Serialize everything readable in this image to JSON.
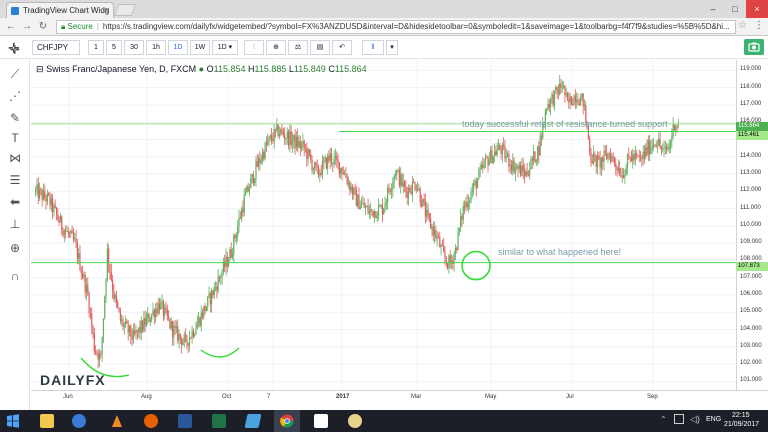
{
  "browser": {
    "tab_title": "TradingView Chart Widg",
    "address_secure": "Secure",
    "url": "https://s.tradingview.com/dailyfx/widgetembed/?symbol=FX%3ANZDUSD&interval=D&hidesidetoolbar=0&symboledit=1&saveimage=1&toolbarbg=f4f7f9&studies=%5B%5D&hi..."
  },
  "toolbar": {
    "symbol": "CHFJPY",
    "intervals": [
      "1",
      "5",
      "30",
      "1h",
      "1D",
      "1W",
      "1D"
    ],
    "active_interval": "1D"
  },
  "legend": {
    "name": "Swiss Franc/Japanese Yen, D, FXCM",
    "open_label": "O",
    "open": "115.854",
    "high_label": "H",
    "high": "115.885",
    "low_label": "L",
    "low": "115.849",
    "close_label": "C",
    "close": "115.864"
  },
  "annotations": {
    "top_text": "today successful retest of resistance turned support",
    "mid_text": "similar to what happened here!"
  },
  "price_tags": {
    "current": "115.864",
    "resistance": "115.461",
    "support": "107.873"
  },
  "logo_text": "DAILYFX",
  "taskbar": {
    "lang": "ENG",
    "time": "22:15",
    "date": "21/09/2017"
  },
  "chart_data": {
    "type": "candlestick",
    "title": "Swiss Franc/Japanese Yen, D, FXCM",
    "x_labels": [
      "Jun",
      "Aug",
      "Oct",
      "7",
      "2017",
      "Mar",
      "May",
      "Jul",
      "Sep"
    ],
    "ylim": [
      100.5,
      119.6
    ],
    "y_ticks": [
      101.0,
      102.0,
      103.0,
      104.0,
      105.0,
      106.0,
      107.0,
      108.0,
      109.0,
      110.0,
      111.0,
      112.0,
      113.0,
      114.0,
      115.0,
      116.0,
      117.0,
      118.0,
      119.0
    ],
    "path_anchors": [
      [
        0,
        112.0
      ],
      [
        10,
        111.5
      ],
      [
        20,
        110.0
      ],
      [
        30,
        109.0
      ],
      [
        40,
        106.0
      ],
      [
        45,
        103.0
      ],
      [
        50,
        102.3
      ],
      [
        55,
        108.5
      ],
      [
        60,
        106.0
      ],
      [
        65,
        104.5
      ],
      [
        75,
        103.5
      ],
      [
        85,
        104.5
      ],
      [
        95,
        105.5
      ],
      [
        105,
        104.0
      ],
      [
        115,
        103.2
      ],
      [
        125,
        104.5
      ],
      [
        135,
        106.0
      ],
      [
        150,
        108.5
      ],
      [
        160,
        111.5
      ],
      [
        170,
        113.5
      ],
      [
        178,
        114.8
      ],
      [
        186,
        115.5
      ],
      [
        196,
        115.0
      ],
      [
        206,
        114.5
      ],
      [
        216,
        113.0
      ],
      [
        226,
        114.0
      ],
      [
        236,
        113.2
      ],
      [
        246,
        111.5
      ],
      [
        256,
        110.8
      ],
      [
        266,
        111.0
      ],
      [
        276,
        113.2
      ],
      [
        284,
        112.0
      ],
      [
        292,
        112.5
      ],
      [
        300,
        110.5
      ],
      [
        308,
        109.3
      ],
      [
        314,
        108.0
      ],
      [
        318,
        107.8
      ],
      [
        322,
        108.6
      ],
      [
        328,
        111.0
      ],
      [
        336,
        112.2
      ],
      [
        346,
        113.8
      ],
      [
        356,
        114.5
      ],
      [
        366,
        113.5
      ],
      [
        376,
        113.0
      ],
      [
        386,
        114.5
      ],
      [
        392,
        117.0
      ],
      [
        398,
        117.5
      ],
      [
        404,
        118.2
      ],
      [
        408,
        117.0
      ],
      [
        414,
        117.6
      ],
      [
        420,
        117.2
      ],
      [
        426,
        114.0
      ],
      [
        432,
        113.6
      ],
      [
        440,
        114.2
      ],
      [
        450,
        113.0
      ],
      [
        456,
        114.0
      ],
      [
        464,
        113.8
      ],
      [
        470,
        114.5
      ],
      [
        476,
        115.0
      ],
      [
        482,
        114.2
      ],
      [
        486,
        114.6
      ],
      [
        490,
        116.0
      ],
      [
        493,
        115.86
      ]
    ],
    "series": [
      {
        "name": "resistance turned support",
        "type": "hline",
        "value": 115.461
      },
      {
        "name": "support",
        "type": "hline",
        "value": 107.873
      },
      {
        "name": "upper band",
        "type": "hline",
        "value": 115.9
      }
    ],
    "grid": true
  }
}
